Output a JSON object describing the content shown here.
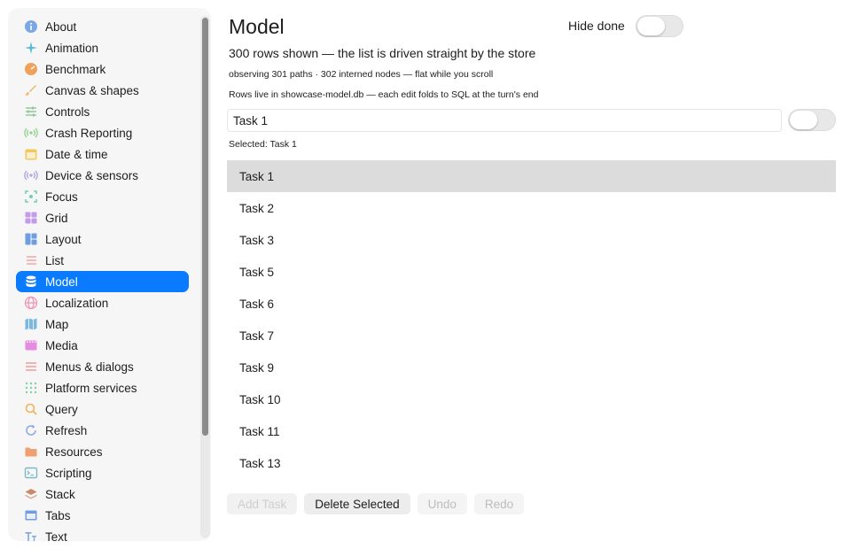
{
  "sidebar": {
    "items": [
      {
        "label": "About",
        "icon": "info-icon",
        "color": "#7aa7e6"
      },
      {
        "label": "Animation",
        "icon": "sparkles-icon",
        "color": "#5bb8d6"
      },
      {
        "label": "Benchmark",
        "icon": "gauge-icon",
        "color": "#f0a05a"
      },
      {
        "label": "Canvas & shapes",
        "icon": "brush-icon",
        "color": "#f2b266"
      },
      {
        "label": "Controls",
        "icon": "sliders-icon",
        "color": "#8fc79a"
      },
      {
        "label": "Crash Reporting",
        "icon": "signal-icon",
        "color": "#8fd18a"
      },
      {
        "label": "Date & time",
        "icon": "calendar-icon",
        "color": "#f2c85b"
      },
      {
        "label": "Device & sensors",
        "icon": "sensor-icon",
        "color": "#a9a3e0"
      },
      {
        "label": "Focus",
        "icon": "focus-icon",
        "color": "#6fd0b5"
      },
      {
        "label": "Grid",
        "icon": "grid-icon",
        "color": "#c49be8"
      },
      {
        "label": "Layout",
        "icon": "layout-icon",
        "color": "#6f9de0"
      },
      {
        "label": "List",
        "icon": "list-icon",
        "color": "#f2a0a0"
      },
      {
        "label": "Model",
        "icon": "database-icon",
        "color": "#ffffff"
      },
      {
        "label": "Localization",
        "icon": "globe-icon",
        "color": "#f08fb0"
      },
      {
        "label": "Map",
        "icon": "map-icon",
        "color": "#7ab8e0"
      },
      {
        "label": "Media",
        "icon": "film-icon",
        "color": "#e58be0"
      },
      {
        "label": "Menus & dialogs",
        "icon": "menu-icon",
        "color": "#f29a9a"
      },
      {
        "label": "Platform services",
        "icon": "dots-grid-icon",
        "color": "#7fcfa8"
      },
      {
        "label": "Query",
        "icon": "magnifier-icon",
        "color": "#f0b45a"
      },
      {
        "label": "Refresh",
        "icon": "refresh-icon",
        "color": "#8ea6e6"
      },
      {
        "label": "Resources",
        "icon": "folder-icon",
        "color": "#f0a070"
      },
      {
        "label": "Scripting",
        "icon": "terminal-icon",
        "color": "#7fb8c8"
      },
      {
        "label": "Stack",
        "icon": "stack-icon",
        "color": "#c98a6a"
      },
      {
        "label": "Tabs",
        "icon": "tabs-icon",
        "color": "#6f9de0"
      },
      {
        "label": "Text",
        "icon": "text-icon",
        "color": "#7aa7e6"
      }
    ],
    "active_index": 12
  },
  "main": {
    "title": "Model",
    "hide_done_label": "Hide done",
    "subtitle": "300 rows shown — the list is driven straight by the store",
    "observing_note": "observing 301 paths · 302 interned nodes — flat while you scroll",
    "storage_note": "Rows live in showcase-model.db — each edit folds to SQL at the turn's end",
    "input_value": "Task 1",
    "selected_text": "Selected: Task 1",
    "tasks": [
      "Task 1",
      "Task 2",
      "Task 3",
      "Task 5",
      "Task 6",
      "Task 7",
      "Task 9",
      "Task 10",
      "Task 11",
      "Task 13"
    ],
    "selected_task_index": 0,
    "buttons": {
      "add": "Add Task",
      "delete": "Delete Selected",
      "undo": "Undo",
      "redo": "Redo"
    }
  },
  "colors": {
    "accent": "#0a7aff",
    "selected_row": "#dcdcdc"
  }
}
